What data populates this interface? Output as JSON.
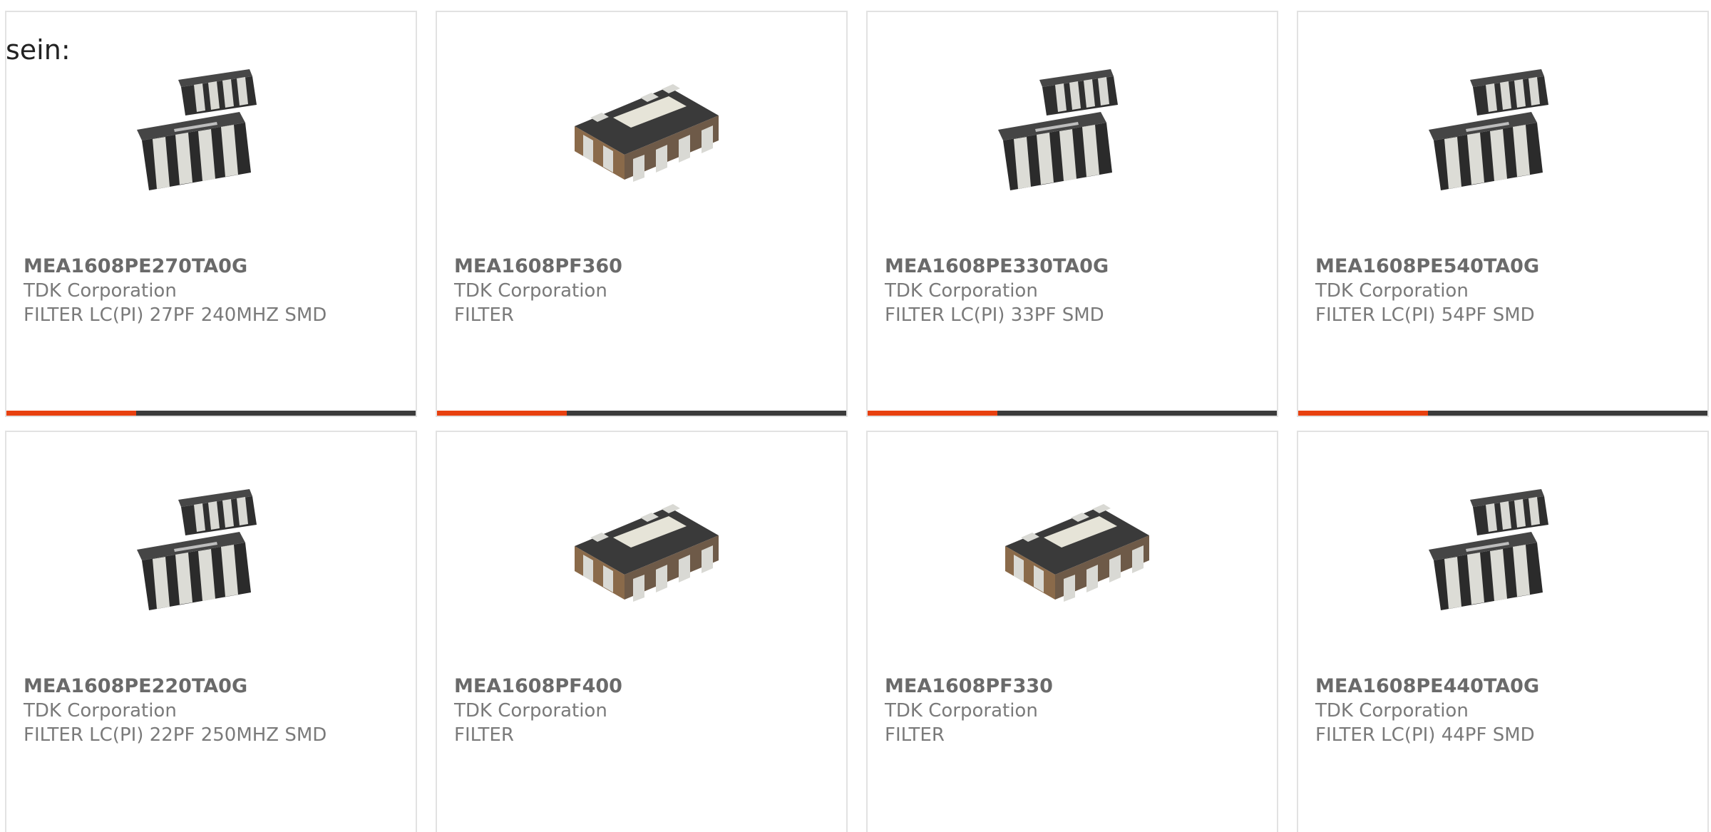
{
  "intro_text": "sein:",
  "colors": {
    "accent": "#e8400f",
    "bar_dark": "#3b3b3b",
    "card_border": "#e2e2e2",
    "text_muted": "#7a7a7a"
  },
  "products": [
    {
      "part_number": "MEA1608PE270TA0G",
      "manufacturer": "TDK Corporation",
      "description": "FILTER LC(PI) 27PF 240MHZ SMD",
      "image": "dual-chip-filter-icon"
    },
    {
      "part_number": "MEA1608PF360",
      "manufacturer": "TDK Corporation",
      "description": "FILTER",
      "image": "single-chip-filter-icon"
    },
    {
      "part_number": "MEA1608PE330TA0G",
      "manufacturer": "TDK Corporation",
      "description": "FILTER LC(PI) 33PF SMD",
      "image": "dual-chip-filter-icon"
    },
    {
      "part_number": "MEA1608PE540TA0G",
      "manufacturer": "TDK Corporation",
      "description": "FILTER LC(PI) 54PF SMD",
      "image": "dual-chip-filter-icon"
    },
    {
      "part_number": "MEA1608PE220TA0G",
      "manufacturer": "TDK Corporation",
      "description": "FILTER LC(PI) 22PF 250MHZ SMD",
      "image": "dual-chip-filter-icon"
    },
    {
      "part_number": "MEA1608PF400",
      "manufacturer": "TDK Corporation",
      "description": "FILTER",
      "image": "single-chip-filter-icon"
    },
    {
      "part_number": "MEA1608PF330",
      "manufacturer": "TDK Corporation",
      "description": "FILTER",
      "image": "single-chip-filter-icon"
    },
    {
      "part_number": "MEA1608PE440TA0G",
      "manufacturer": "TDK Corporation",
      "description": "FILTER LC(PI) 44PF SMD",
      "image": "dual-chip-filter-icon"
    }
  ]
}
